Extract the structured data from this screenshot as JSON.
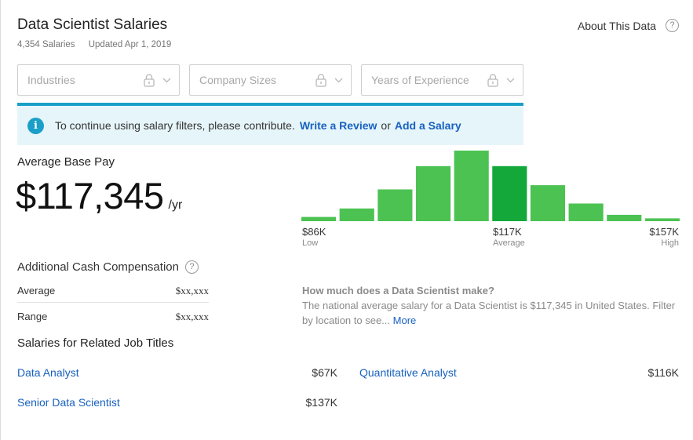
{
  "header": {
    "title": "Data Scientist Salaries",
    "count": "4,354 Salaries",
    "updated": "Updated Apr 1, 2019",
    "about_label": "About This Data",
    "help_glyph": "?"
  },
  "filters": [
    {
      "label": "Industries",
      "icon": "lock-icon"
    },
    {
      "label": "Company Sizes",
      "icon": "lock-icon"
    },
    {
      "label": "Years of Experience",
      "icon": "lock-icon"
    }
  ],
  "banner": {
    "icon_glyph": "i",
    "text": "To continue using salary filters, please contribute.",
    "link1": "Write a Review",
    "or": "or",
    "link2": "Add a Salary"
  },
  "base_pay": {
    "label": "Average Base Pay",
    "amount": "$117,345",
    "unit": "/yr"
  },
  "histogram": {
    "low_value": "$86K",
    "low_label": "Low",
    "avg_value": "$117K",
    "avg_label": "Average",
    "high_value": "$157K",
    "high_label": "High",
    "bar_levels": [
      0.06,
      0.18,
      0.45,
      0.78,
      1.0,
      0.78,
      0.51,
      0.25,
      0.09,
      0.04
    ],
    "highlight_index": 5,
    "color": "#4cc252",
    "highlight_color": "#14a83b"
  },
  "additional_cash": {
    "title": "Additional Cash Compensation",
    "help_glyph": "?",
    "rows": [
      {
        "label": "Average",
        "value": "$xx,xxx"
      },
      {
        "label": "Range",
        "value": "$xx,xxx"
      }
    ]
  },
  "faq": {
    "question": "How much does a Data Scientist make?",
    "answer": "The national average salary for a Data Scientist is $117,345 in United States. Filter by location to see...",
    "more_label": "More"
  },
  "related": {
    "title": "Salaries for Related Job Titles",
    "items": [
      {
        "title": "Data Analyst",
        "salary": "$67K"
      },
      {
        "title": "Quantitative Analyst",
        "salary": "$116K"
      },
      {
        "title": "Senior Data Scientist",
        "salary": "$137K"
      }
    ]
  },
  "colors": {
    "link": "#1861bf",
    "banner_bg": "#e6f5fa",
    "banner_accent": "#1aa0c8"
  }
}
